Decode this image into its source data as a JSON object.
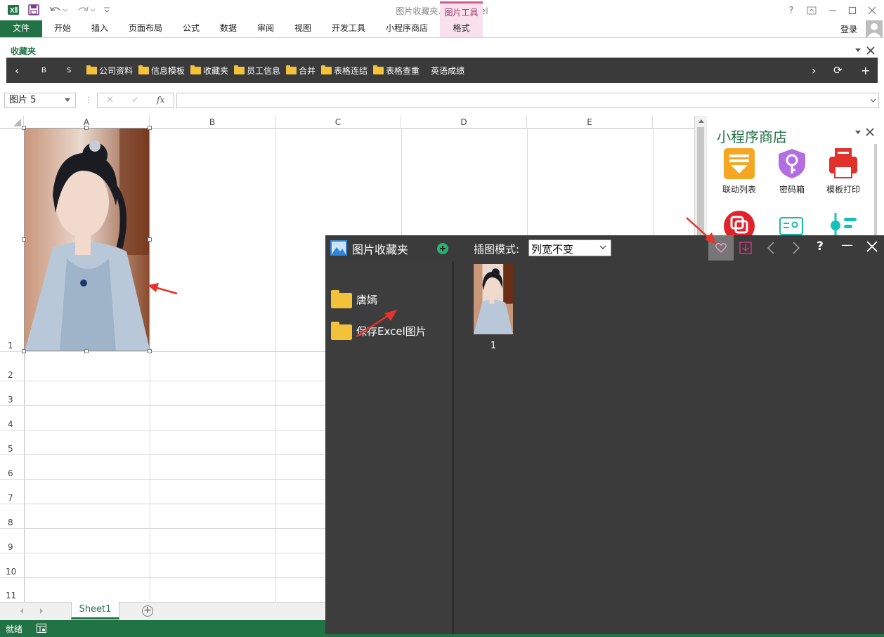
{
  "window": {
    "title": "图片收藏夹.xlsx - Excel",
    "login": "登录",
    "help": "?",
    "controls": [
      "?",
      "⊡",
      "—",
      "☐",
      "✕"
    ]
  },
  "ribbon": {
    "file_tab": "文件",
    "tabs": [
      "开始",
      "插入",
      "页面布局",
      "公式",
      "数据",
      "审阅",
      "视图",
      "开发工具",
      "小程序商店"
    ],
    "context_group": "图片工具",
    "context_tab": "格式"
  },
  "favorites": {
    "title": "收藏夹",
    "nav_left": "‹",
    "b": "B",
    "s": "S",
    "items": [
      "公司资料",
      "信息模板",
      "收藏夹",
      "员工信息",
      "合并",
      "表格连结",
      "表格查重"
    ],
    "last_item": "英语成绩",
    "nav_right": "›",
    "refresh": "⟳",
    "add": "+"
  },
  "formula_bar": {
    "name_box": "图片 5",
    "cancel": "✕",
    "confirm": "✓",
    "fx": "fx",
    "formula": ""
  },
  "grid": {
    "columns": [
      "A",
      "B",
      "C",
      "D",
      "E"
    ],
    "rows": [
      "1",
      "2",
      "3",
      "4",
      "5",
      "6",
      "7",
      "8",
      "9",
      "10",
      "11"
    ]
  },
  "store": {
    "title": "小程序商店",
    "items": [
      {
        "label": "联动列表",
        "icon": "linked-list-icon",
        "color": "#f5a623"
      },
      {
        "label": "密码箱",
        "icon": "password-box-icon",
        "color": "#b26de0"
      },
      {
        "label": "模板打印",
        "icon": "template-print-icon",
        "color": "#e0322b"
      }
    ],
    "row2_icons": [
      {
        "icon": "merge-icon",
        "color": "#e0222b"
      },
      {
        "icon": "id-card-icon",
        "color": "#18b7b0"
      },
      {
        "icon": "settings-list-icon",
        "color": "#18c1b8"
      }
    ]
  },
  "image_window": {
    "title": "图片收藏夹",
    "mode_label": "插图模式:",
    "mode_value": "列宽不变",
    "folders": [
      "唐嫣",
      "保存Excel图片"
    ],
    "thumbnails": [
      {
        "caption": "1"
      }
    ],
    "help": "?",
    "minimize": "—",
    "close": "✕"
  },
  "sheets": {
    "active": "Sheet1",
    "add": "+"
  },
  "status": {
    "text": "就绪"
  },
  "colors": {
    "excel_green": "#217346",
    "context_pink": "#f8e1ec",
    "dark_panel": "#3b3b3b",
    "folder": "#f3c13a",
    "arrow_red": "#e8322b"
  }
}
